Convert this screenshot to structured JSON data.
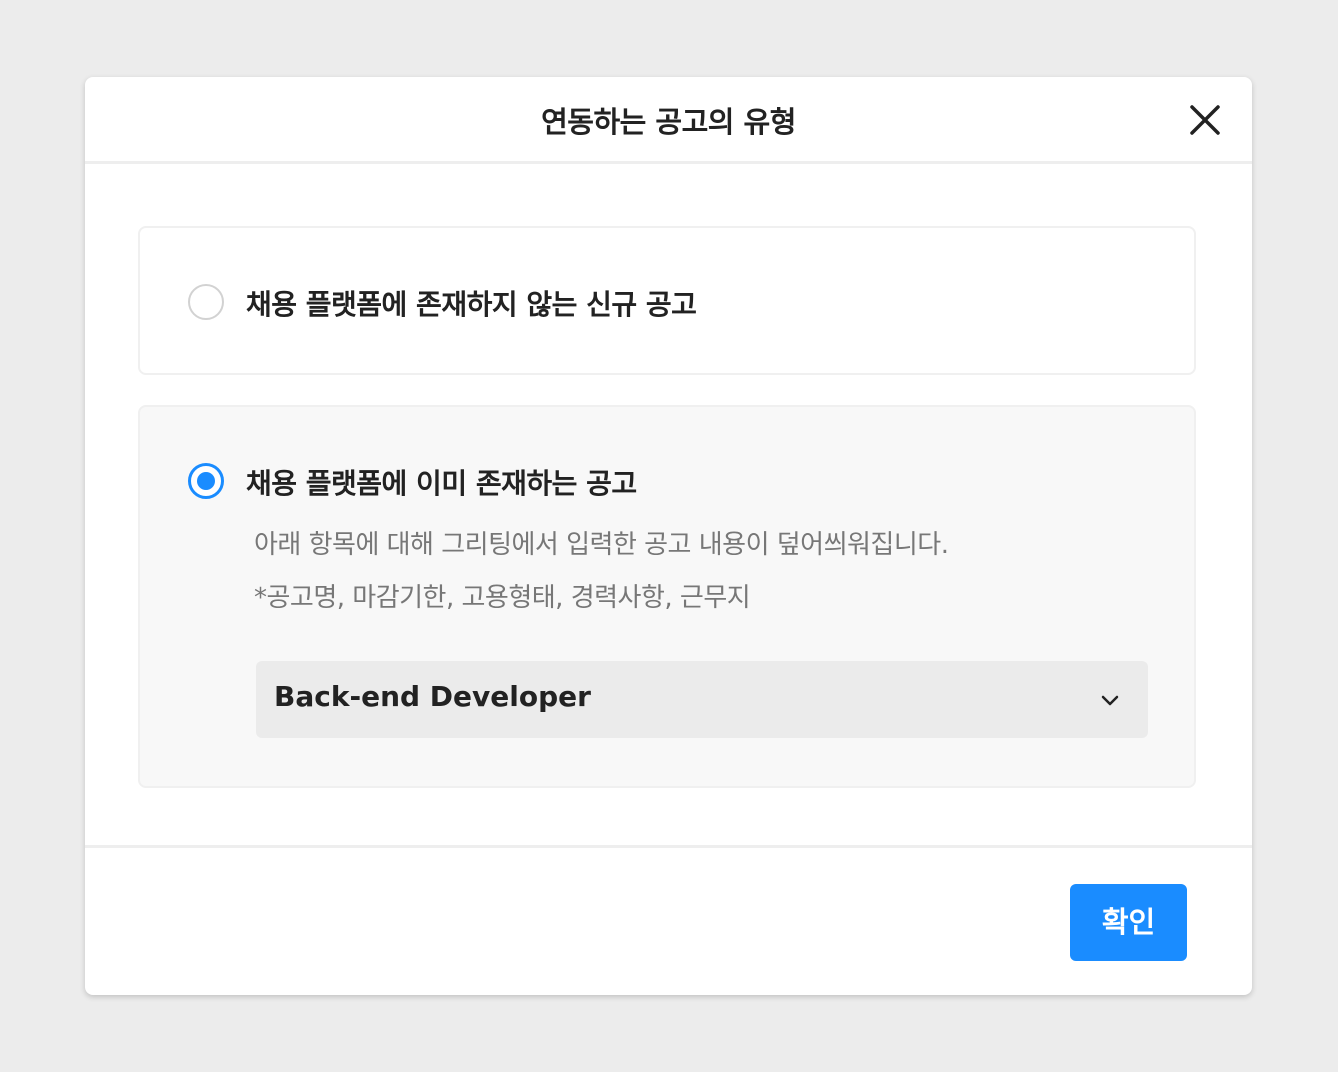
{
  "modal": {
    "title": "연동하는 공고의 유형",
    "close_icon": "close-icon"
  },
  "options": [
    {
      "label": "채용 플랫폼에 존재하지 않는 신규 공고",
      "checked": false
    },
    {
      "label": "채용 플랫폼에 이미 존재하는 공고",
      "checked": true,
      "description_line_1": "아래 항목에 대해 그리팅에서 입력한 공고 내용이 덮어씌워집니다.",
      "description_line_2": "*공고명, 마감기한, 고용형태, 경력사항, 근무지",
      "select": {
        "value": "Back-end Developer",
        "icon": "chevron-down-icon"
      }
    }
  ],
  "footer": {
    "confirm_label": "확인"
  },
  "colors": {
    "accent": "#1a8cff",
    "background": "#ececec",
    "text_primary": "#222222",
    "text_secondary": "#777777"
  }
}
